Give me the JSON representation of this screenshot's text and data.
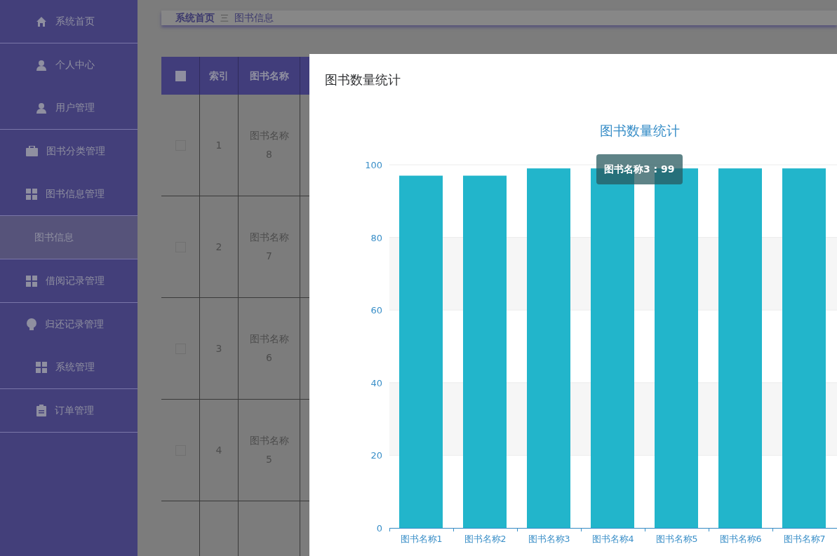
{
  "sidebar": {
    "groups": [
      {
        "items": [
          {
            "label": "系统首页",
            "kind": "menu",
            "selected": false
          }
        ]
      },
      {
        "items": [
          {
            "label": "个人中心",
            "kind": "menu",
            "selected": false
          },
          {
            "label": "用户管理",
            "kind": "menu",
            "selected": false
          }
        ]
      },
      {
        "items": [
          {
            "label": "图书分类管理",
            "kind": "menu",
            "selected": false
          },
          {
            "label": "图书信息管理",
            "kind": "menu",
            "selected": false
          }
        ]
      },
      {
        "items": [
          {
            "label": "图书信息",
            "kind": "submenu",
            "selected": true
          }
        ]
      },
      {
        "items": [
          {
            "label": "借阅记录管理",
            "kind": "menu",
            "selected": false
          }
        ]
      },
      {
        "items": [
          {
            "label": "归还记录管理",
            "kind": "menu",
            "selected": false
          },
          {
            "label": "系统管理",
            "kind": "menu",
            "selected": false
          }
        ]
      },
      {
        "items": [
          {
            "label": "订单管理",
            "kind": "menu",
            "selected": false
          }
        ]
      }
    ]
  },
  "breadcrumb": [
    {
      "label": "系统首页",
      "kind": "link"
    },
    {
      "label": "三",
      "kind": "separator"
    },
    {
      "label": "图书信息",
      "kind": "current"
    }
  ],
  "table": {
    "header_checked": false,
    "columns": [
      "索引",
      "图书名称"
    ],
    "rows": [
      {
        "checked": false,
        "index": "1",
        "name": "图书名称8"
      },
      {
        "checked": false,
        "index": "2",
        "name": "图书名称7"
      },
      {
        "checked": false,
        "index": "3",
        "name": "图书名称6"
      },
      {
        "checked": false,
        "index": "4",
        "name": "图书名称5"
      }
    ]
  },
  "modal": {
    "title": "图书数量统计",
    "tooltip": "图书名称3 : 99",
    "chart_data": {
      "type": "bar",
      "title": "图书数量统计",
      "categories": [
        "图书名称1",
        "图书名称2",
        "图书名称3",
        "图书名称4",
        "图书名称5",
        "图书名称6",
        "图书名称7"
      ],
      "series": [
        {
          "color": "#22b5cb",
          "values": [
            97,
            97,
            99,
            99,
            99,
            99,
            99
          ]
        }
      ],
      "ylim": [
        0,
        100
      ],
      "yticks": [
        0,
        20,
        40,
        60,
        80,
        100
      ],
      "grid": true
    }
  }
}
